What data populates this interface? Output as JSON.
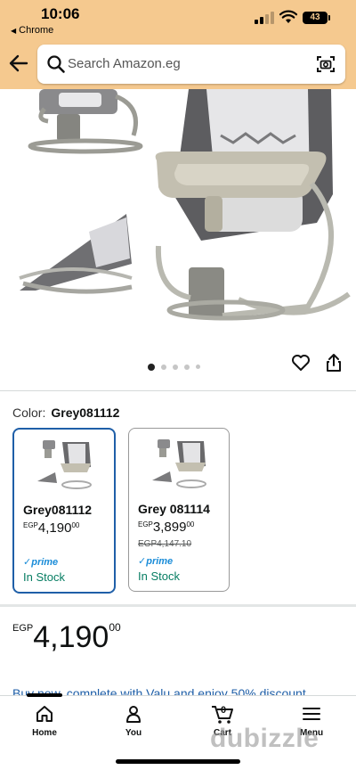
{
  "status_bar": {
    "time": "10:06",
    "back_app": "Chrome",
    "battery": "43"
  },
  "search": {
    "placeholder": "Search Amazon.eg"
  },
  "gallery": {
    "dot_count": 5,
    "active_index": 0
  },
  "color": {
    "label": "Color:",
    "value": "Grey081112"
  },
  "variants": [
    {
      "name": "Grey081112",
      "currency": "EGP",
      "whole": "4,190",
      "decimal": "00",
      "strike": "",
      "prime": "prime",
      "stock": "In Stock",
      "selected": true
    },
    {
      "name": "Grey 081114",
      "currency": "EGP",
      "whole": "3,899",
      "decimal": "00",
      "strike": "EGP4,147.10",
      "prime": "prime",
      "stock": "In Stock",
      "selected": false
    }
  ],
  "price": {
    "currency": "EGP",
    "whole": "4,190",
    "decimal": "00"
  },
  "promo": "Buy now, complete with Valu and enjoy 50% discount",
  "nav": [
    {
      "label": "Home",
      "icon": "home-icon"
    },
    {
      "label": "You",
      "icon": "user-icon"
    },
    {
      "label": "Cart",
      "icon": "cart-icon",
      "count": "0"
    },
    {
      "label": "Menu",
      "icon": "menu-icon"
    }
  ],
  "watermark": {
    "text": "dubizzle"
  },
  "colors": {
    "header": "#f5c98f",
    "selected_border": "#1f5fa8",
    "in_stock": "#067d62",
    "prime": "#1a8cd8"
  }
}
